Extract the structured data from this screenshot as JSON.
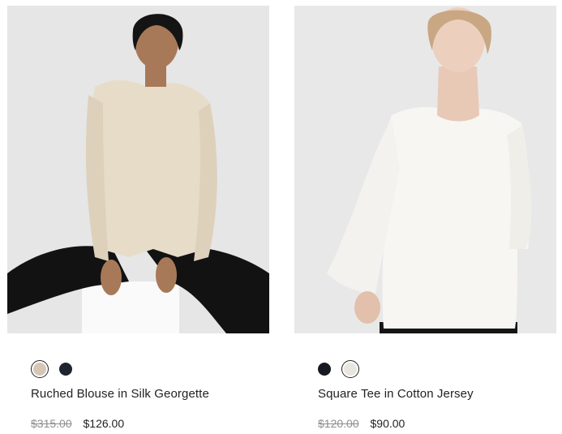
{
  "products": [
    {
      "name": "Ruched Blouse in Silk Georgette",
      "original_price": "$315.00",
      "sale_price": "$126.00",
      "swatches": [
        {
          "color": "#d7c6b4",
          "selected": true
        },
        {
          "color": "#1e2530",
          "selected": false
        }
      ],
      "image_alt": "Model in beige silk blouse and black pants seated on a white block"
    },
    {
      "name": "Square Tee in Cotton Jersey",
      "original_price": "$120.00",
      "sale_price": "$90.00",
      "swatches": [
        {
          "color": "#161a20",
          "selected": false
        },
        {
          "color": "#e8e6df",
          "selected": true
        }
      ],
      "image_alt": "Model in white cotton jersey long-sleeve tee"
    }
  ]
}
